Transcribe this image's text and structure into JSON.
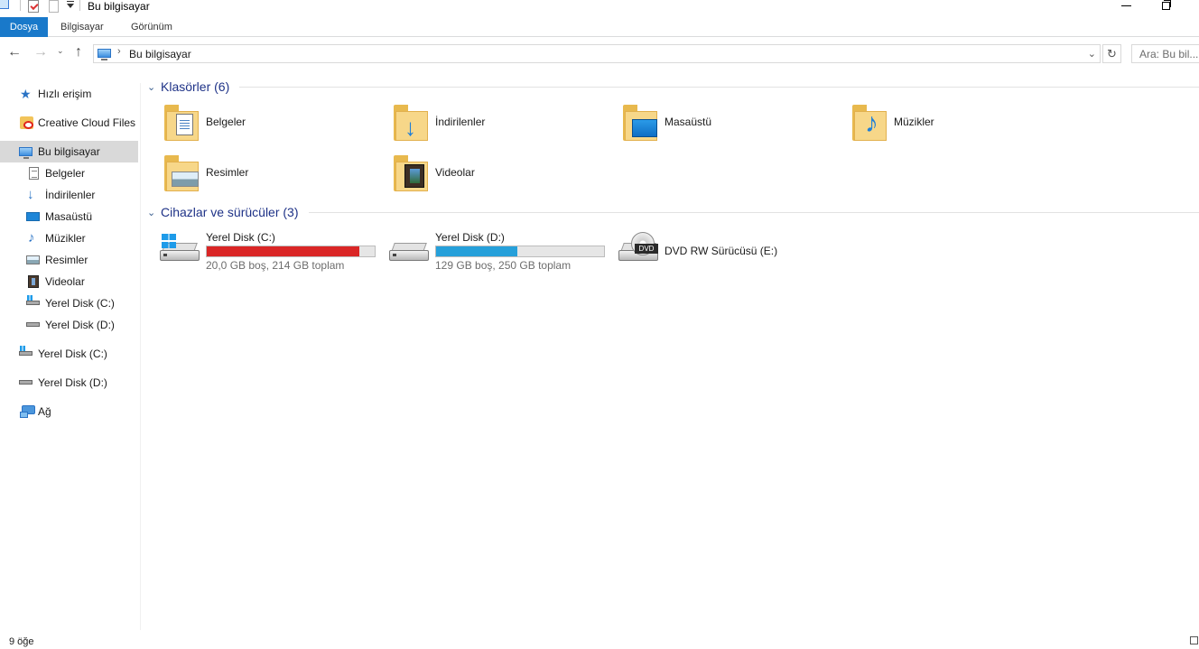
{
  "window": {
    "title": "Bu bilgisayar"
  },
  "ribbon": {
    "tabs": [
      "Dosya",
      "Bilgisayar",
      "Görünüm"
    ]
  },
  "navigation": {
    "back_icon": "←",
    "forward_icon": "→",
    "recent_icon": "⌄",
    "up_icon": "↑",
    "address_separator": "›",
    "address": "Bu bilgisayar",
    "address_dropdown_icon": "⌄",
    "refresh_icon": "↻",
    "search_placeholder": "Ara: Bu bil..."
  },
  "sidebar": {
    "items": [
      {
        "label": "Hızlı erişim",
        "icon": "star-icon",
        "level": 0
      },
      {
        "label": "Creative Cloud Files",
        "icon": "creative-cloud-icon",
        "level": 0
      },
      {
        "label": "Bu bilgisayar",
        "icon": "computer-icon",
        "level": 0,
        "selected": true
      },
      {
        "label": "Belgeler",
        "icon": "documents-icon",
        "level": 1
      },
      {
        "label": "İndirilenler",
        "icon": "downloads-icon",
        "level": 1
      },
      {
        "label": "Masaüstü",
        "icon": "desktop-icon",
        "level": 1
      },
      {
        "label": "Müzikler",
        "icon": "music-icon",
        "level": 1
      },
      {
        "label": "Resimler",
        "icon": "pictures-icon",
        "level": 1
      },
      {
        "label": "Videolar",
        "icon": "videos-icon",
        "level": 1
      },
      {
        "label": "Yerel Disk (C:)",
        "icon": "system-drive-icon",
        "level": 1
      },
      {
        "label": "Yerel Disk (D:)",
        "icon": "drive-icon",
        "level": 1
      },
      {
        "label": "Yerel Disk (C:)",
        "icon": "system-drive-icon",
        "level": 0
      },
      {
        "label": "Yerel Disk (D:)",
        "icon": "drive-icon",
        "level": 0
      },
      {
        "label": "Ağ",
        "icon": "network-icon",
        "level": 0
      }
    ]
  },
  "folders_group": {
    "title": "Klasörler (6)",
    "items": [
      {
        "label": "Belgeler",
        "icon": "documents-folder-icon"
      },
      {
        "label": "İndirilenler",
        "icon": "downloads-folder-icon"
      },
      {
        "label": "Masaüstü",
        "icon": "desktop-folder-icon"
      },
      {
        "label": "Müzikler",
        "icon": "music-folder-icon"
      },
      {
        "label": "Resimler",
        "icon": "pictures-folder-icon"
      },
      {
        "label": "Videolar",
        "icon": "videos-folder-icon"
      }
    ]
  },
  "devices_group": {
    "title": "Cihazlar ve sürücüler (3)",
    "drives": [
      {
        "name": "Yerel Disk (C:)",
        "free_text": "20,0 GB boş, 214 GB toplam",
        "used_fraction": 0.907,
        "bar_color": "#da2626",
        "icon": "system-drive-icon"
      },
      {
        "name": "Yerel Disk (D:)",
        "free_text": "129 GB boş, 250 GB toplam",
        "used_fraction": 0.484,
        "bar_color": "#26a0da",
        "icon": "drive-icon"
      },
      {
        "name": "DVD RW Sürücüsü (E:)",
        "badge": "DVD",
        "icon": "dvd-drive-icon"
      }
    ]
  },
  "statusbar": {
    "item_count": "9 öğe"
  },
  "colors": {
    "accent": "#1979ca",
    "group_title": "#1e3287",
    "selection": "#d9d9d9"
  }
}
